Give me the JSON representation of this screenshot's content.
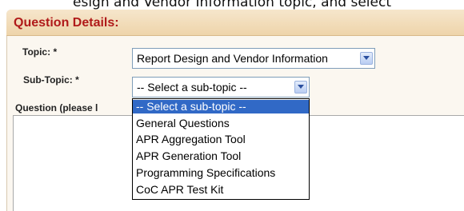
{
  "top_text": "esign and Vendor Information topic, and select",
  "panel": {
    "title": "Question Details:"
  },
  "topic": {
    "label": "Topic:",
    "required": "*",
    "value": "Report Design and Vendor Information"
  },
  "subtopic": {
    "label": "Sub-Topic:",
    "required": "*",
    "value": "-- Select a sub-topic --",
    "options": [
      "-- Select a sub-topic --",
      "General Questions",
      "APR Aggregation Tool",
      "APR Generation Tool",
      "Programming Specifications",
      "CoC APR Test Kit"
    ],
    "highlighted_index": 0
  },
  "question": {
    "label": "Question (please l"
  },
  "icons": {
    "dropdown": "chevron-down-icon"
  },
  "colors": {
    "title": "#b01a1a",
    "highlight": "#3169c6",
    "header_bg": "#f2dcb8"
  }
}
